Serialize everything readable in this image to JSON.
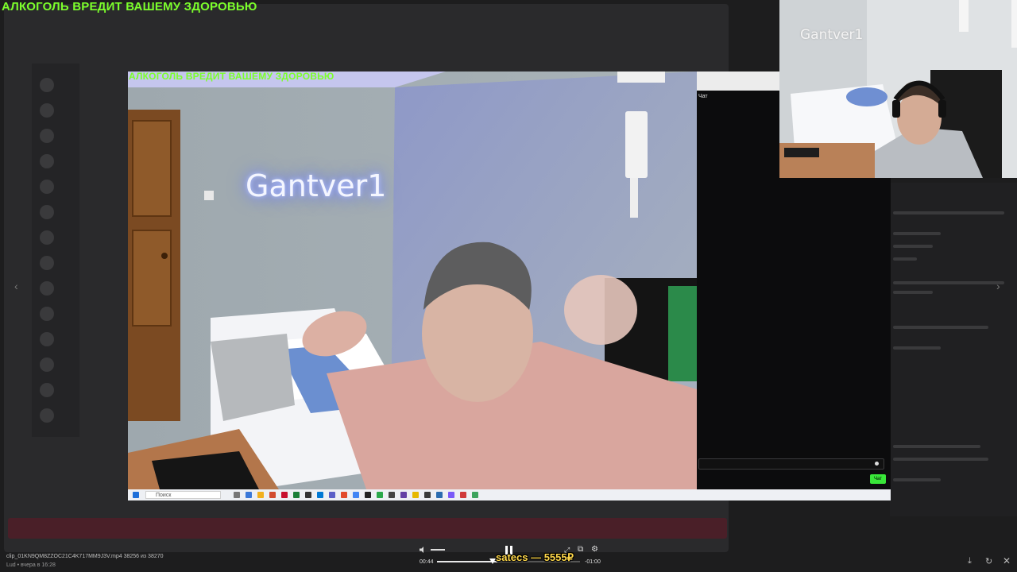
{
  "overlay": {
    "top_warning": "АЛКОГОЛЬ ВРЕДИТ ВАШЕМУ ЗДОРОВЬЮ",
    "inner_warning": "АЛКОГОЛЬ ВРЕДИТ ВАШЕМУ ЗДОРОВЬЮ",
    "donation": "satecs — 5555₽"
  },
  "main_video": {
    "neon_sign": "Gantver1"
  },
  "webcam": {
    "neon_sign": "Gantver1"
  },
  "chat": {
    "label": "Чат",
    "send_label": "Чат"
  },
  "taskbar": {
    "search_placeholder": "Поиск"
  },
  "player": {
    "file_name": "clip_01KN9QM8ZZOC21C4K717MM9J3V.mp4 38256 из 38270",
    "file_meta": "Lud • вчера в 16:28",
    "time_current": "00:44",
    "time_remaining": "-01:00",
    "progress_fraction": 0.42,
    "volume_fraction": 1.0
  },
  "icons": {
    "volume": "volume-icon",
    "pause": "pause-icon",
    "expand": "expand-icon",
    "pip": "picture-in-picture-icon",
    "settings": "gear-icon",
    "download": "download-icon",
    "rotate": "rotate-icon",
    "close": "close-icon",
    "prev": "chevron-left-icon",
    "next": "chevron-right-icon"
  },
  "colors": {
    "warning": "#7CFF2B",
    "donation": "#FFD84A",
    "send": "#39E639"
  }
}
